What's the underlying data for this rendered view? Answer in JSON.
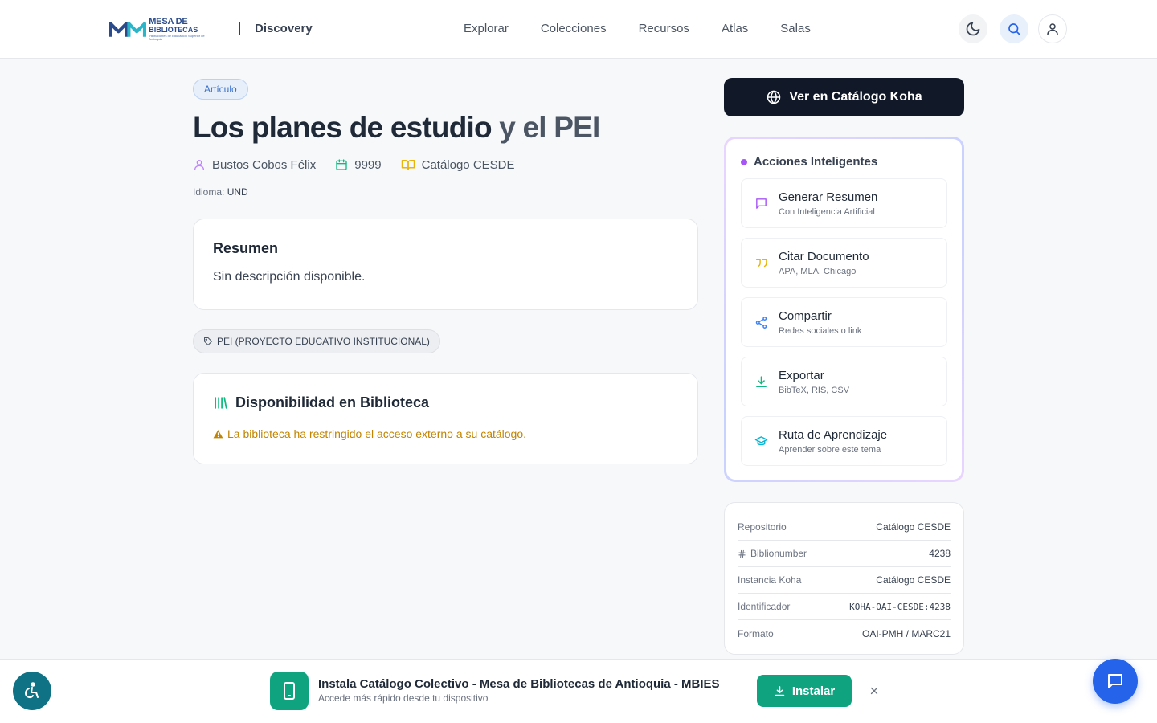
{
  "header": {
    "logo": {
      "line1": "MESA DE",
      "line2": "BIBLIOTECAS",
      "line3": "Instituciones de Educación Superior de Antioquia"
    },
    "brand": "Discovery",
    "nav": [
      "Explorar",
      "Colecciones",
      "Recursos",
      "Atlas",
      "Salas"
    ],
    "icons": [
      "moon-icon",
      "search-icon",
      "user-icon"
    ]
  },
  "record": {
    "type_badge": "Artículo",
    "title_main": "Los planes de estudio",
    "title_rest": " y el PEI",
    "author": "Bustos Cobos Félix",
    "year": "9999",
    "catalog": "Catálogo CESDE",
    "language_label": "Idioma:",
    "language": "UND"
  },
  "summary": {
    "heading": "Resumen",
    "text": "Sin descripción disponible."
  },
  "tag": "PEI (PROYECTO EDUCATIVO INSTITUCIONAL)",
  "availability": {
    "heading": "Disponibilidad en Biblioteca",
    "warning": "La biblioteca ha restringido el acceso externo a su catálogo."
  },
  "koha_button": "Ver en Catálogo Koha",
  "smart_actions": {
    "heading": "Acciones Inteligentes",
    "items": [
      {
        "title": "Generar Resumen",
        "subtitle": "Con Inteligencia Artificial",
        "icon": "message-icon",
        "color": "#a855f7"
      },
      {
        "title": "Citar Documento",
        "subtitle": "APA, MLA, Chicago",
        "icon": "quote-icon",
        "color": "#eab308"
      },
      {
        "title": "Compartir",
        "subtitle": "Redes sociales o link",
        "icon": "share-icon",
        "color": "#3b82f6"
      },
      {
        "title": "Exportar",
        "subtitle": "BibTeX, RIS, CSV",
        "icon": "download-icon",
        "color": "#10b981"
      },
      {
        "title": "Ruta de Aprendizaje",
        "subtitle": "Aprender sobre este tema",
        "icon": "graduation-cap-icon",
        "color": "#06b6d4"
      }
    ]
  },
  "info_table": [
    {
      "key": "Repositorio",
      "value": "Catálogo CESDE"
    },
    {
      "key": "Biblionumber",
      "value": "4238"
    },
    {
      "key": "Instancia Koha",
      "value": "Catálogo CESDE"
    },
    {
      "key": "Identificador",
      "value": "KOHA-OAI-CESDE:4238"
    },
    {
      "key": "Formato",
      "value": "OAI-PMH / MARC21"
    }
  ],
  "install_banner": {
    "title": "Instala Catálogo Colectivo - Mesa de Bibliotecas de Antioquia - MBIES",
    "subtitle": "Accede más rápido desde tu dispositivo",
    "button": "Instalar"
  }
}
